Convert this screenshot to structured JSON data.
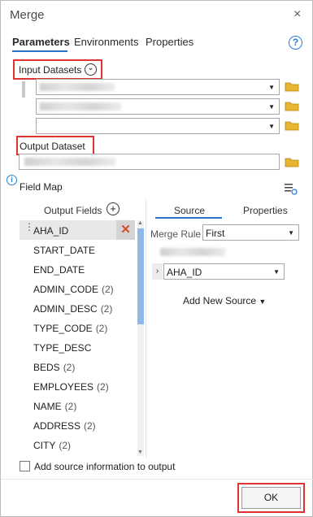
{
  "window": {
    "title": "Merge",
    "close_glyph": "×"
  },
  "tabs": [
    "Parameters",
    "Environments",
    "Properties"
  ],
  "help_glyph": "?",
  "input": {
    "label": "Input Datasets",
    "expand_glyph": "⌄"
  },
  "output": {
    "label": "Output Dataset"
  },
  "field_map": {
    "info_glyph": "i",
    "label": "Field Map",
    "output_fields_label": "Output Fields",
    "add_glyph": "+",
    "delete_glyph": "✕",
    "fields": [
      {
        "name": "AHA_ID",
        "count": ""
      },
      {
        "name": "START_DATE",
        "count": ""
      },
      {
        "name": "END_DATE",
        "count": ""
      },
      {
        "name": "ADMIN_CODE",
        "count": "(2)"
      },
      {
        "name": "ADMIN_DESC",
        "count": "(2)"
      },
      {
        "name": "TYPE_CODE",
        "count": "(2)"
      },
      {
        "name": "TYPE_DESC",
        "count": ""
      },
      {
        "name": "BEDS",
        "count": "(2)"
      },
      {
        "name": "EMPLOYEES",
        "count": "(2)"
      },
      {
        "name": "NAME",
        "count": "(2)"
      },
      {
        "name": "ADDRESS",
        "count": "(2)"
      },
      {
        "name": "CITY",
        "count": "(2)"
      }
    ],
    "source_tabs": [
      "Source",
      "Properties"
    ],
    "merge_rule_label": "Merge Rule",
    "merge_rule_value": "First",
    "source_field_value": "AHA_ID",
    "add_new_source_label": "Add New Source"
  },
  "footer": {
    "checkbox_label": "Add source information to output",
    "ok_label": "OK"
  },
  "colors": {
    "accent": "#2a6fc9",
    "highlight": "#d33333",
    "selected_row": "#e8e8e8",
    "scroll_thumb": "#8fb9e8"
  }
}
